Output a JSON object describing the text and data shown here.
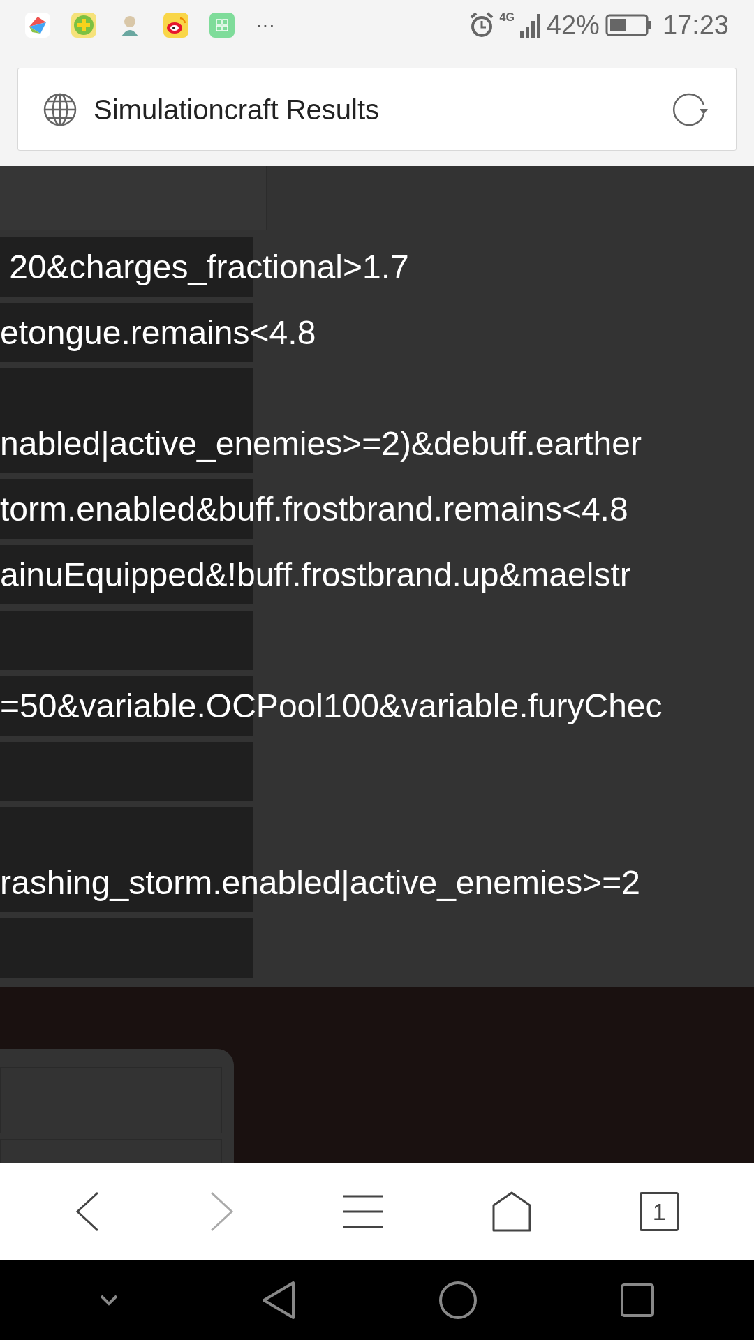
{
  "status_bar": {
    "network": "4G",
    "battery": "42%",
    "time": "17:23",
    "more": "···"
  },
  "address_bar": {
    "title": "Simulationcraft Results"
  },
  "rows": [
    {
      "kind": "single",
      "text": " 20&charges_fractional>1.7"
    },
    {
      "kind": "single",
      "text": "etongue.remains<4.8"
    },
    {
      "kind": "tall",
      "text": "nabled|active_enemies>=2)&debuff.earther"
    },
    {
      "kind": "single",
      "text": "torm.enabled&buff.frostbrand.remains<4.8"
    },
    {
      "kind": "single",
      "text": "ainuEquipped&!buff.frostbrand.up&maelstr"
    },
    {
      "kind": "single"
    },
    {
      "kind": "single",
      "text": "=50&variable.OCPool100&variable.furyChec"
    },
    {
      "kind": "single"
    },
    {
      "kind": "tall",
      "text": "rashing_storm.enabled|active_enemies>=2"
    },
    {
      "kind": "single"
    }
  ],
  "toolbar": {
    "tabs_count": "1"
  }
}
